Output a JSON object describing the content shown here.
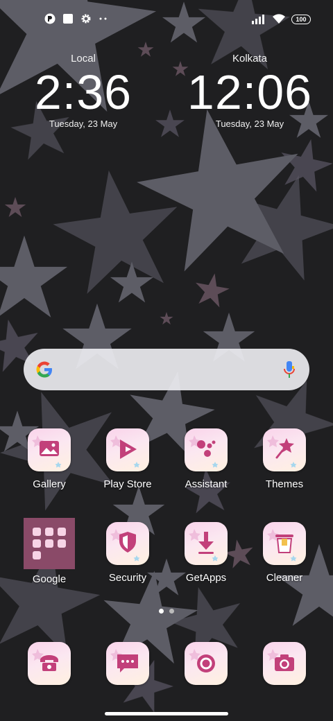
{
  "status_bar": {
    "left_icons": [
      "app-notification-icon",
      "square-notification-icon",
      "gear-icon",
      "more-dots-icon"
    ],
    "right_icons": [
      "signal-icon",
      "wifi-icon",
      "battery-icon"
    ],
    "battery": "100"
  },
  "clocks": [
    {
      "city": "Local",
      "time": "2:36",
      "date": "Tuesday, 23 May"
    },
    {
      "city": "Kolkata",
      "time": "12:06",
      "date": "Tuesday, 23 May"
    }
  ],
  "search": {
    "left_icon": "google-logo-icon",
    "right_icon": "microphone-icon"
  },
  "apps": {
    "row1": [
      {
        "label": "Gallery",
        "icon": "gallery-icon"
      },
      {
        "label": "Play Store",
        "icon": "play-store-icon"
      },
      {
        "label": "Assistant",
        "icon": "assistant-icon"
      },
      {
        "label": "Themes",
        "icon": "themes-icon"
      }
    ],
    "row2": [
      {
        "label": "Google",
        "icon": "folder-icon"
      },
      {
        "label": "Security",
        "icon": "security-icon"
      },
      {
        "label": "GetApps",
        "icon": "getapps-icon"
      },
      {
        "label": "Cleaner",
        "icon": "cleaner-icon"
      }
    ],
    "dock": [
      {
        "icon": "phone-icon"
      },
      {
        "icon": "messages-icon"
      },
      {
        "icon": "browser-icon"
      },
      {
        "icon": "camera-icon"
      }
    ]
  },
  "page_indicator": {
    "pages": 2,
    "current": 1
  },
  "colors": {
    "accent": "#c2407a",
    "tile_pink": "#f9d3ea",
    "background": "#1f1f21",
    "folder": "#8a4a68"
  }
}
